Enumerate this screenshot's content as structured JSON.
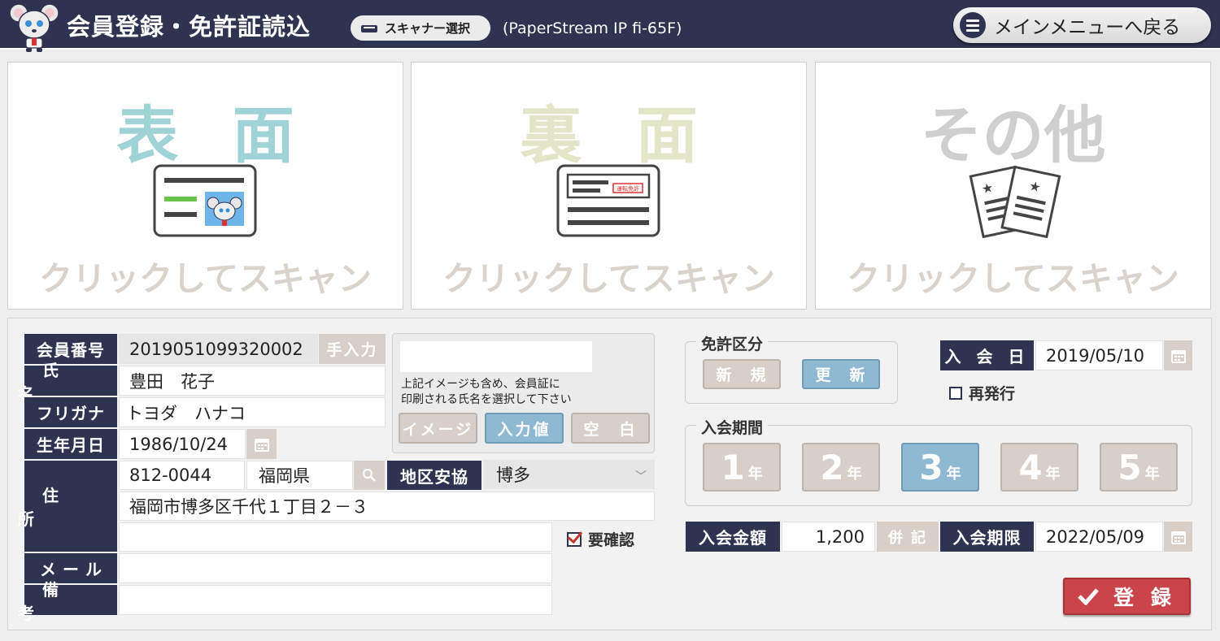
{
  "header": {
    "title": "会員登録・免許証読込",
    "scanner_button": "スキャナー選択",
    "scanner_model": "(PaperStream IP fi-65F)",
    "menu_button": "メインメニューへ戻る"
  },
  "scan_panels": [
    {
      "title": "表 面",
      "caption": "クリックしてスキャン",
      "color": "#9fd3d6"
    },
    {
      "title": "裏 面",
      "caption": "クリックしてスキャン",
      "color": "#e2e5c7"
    },
    {
      "title": "その他",
      "caption": "クリックしてスキャン",
      "color": "#cfcfcf"
    }
  ],
  "back_card_stamp": "運転免許",
  "form": {
    "member_no": {
      "label": "会員番号",
      "value": "2019051099320002",
      "manual_button": "手入力"
    },
    "name": {
      "label": "氏　名",
      "value": "豊田　花子"
    },
    "furigana": {
      "label": "フリガナ",
      "value": "トヨダ　ハナコ"
    },
    "birthdate": {
      "label": "生年月日",
      "value": "1986/10/24"
    },
    "address": {
      "label": "住　所",
      "postal": "812-0044",
      "prefecture": "福岡県",
      "district_label": "地区安協",
      "district_value": "博多",
      "line1": "福岡市博多区千代１丁目２－３",
      "line2": ""
    },
    "needs_confirm": {
      "label": "要確認",
      "checked": true
    },
    "email": {
      "label": "メール",
      "value": ""
    },
    "notes": {
      "label": "備　考",
      "value": ""
    },
    "name_choice": {
      "note_line1": "上記イメージも含め、会員証に",
      "note_line2": "印刷される氏名を選択して下さい",
      "buttons": [
        "イメージ",
        "入力値",
        "空　白"
      ],
      "selected": "入力値"
    }
  },
  "license": {
    "title": "免許区分",
    "options": [
      "新　規",
      "更　新"
    ],
    "selected": "更　新"
  },
  "join_date": {
    "label": "入 会 日",
    "value": "2019/05/10"
  },
  "reissue": {
    "label": "再発行",
    "checked": false
  },
  "period": {
    "title": "入会期間",
    "unit": "年",
    "options": [
      "1",
      "2",
      "3",
      "4",
      "5"
    ],
    "selected": "3"
  },
  "fee": {
    "label": "入会金額",
    "value": "1,200",
    "extra_button": "併 記"
  },
  "expiry": {
    "label": "入会期限",
    "value": "2022/05/09"
  },
  "register_button": "登 録"
}
